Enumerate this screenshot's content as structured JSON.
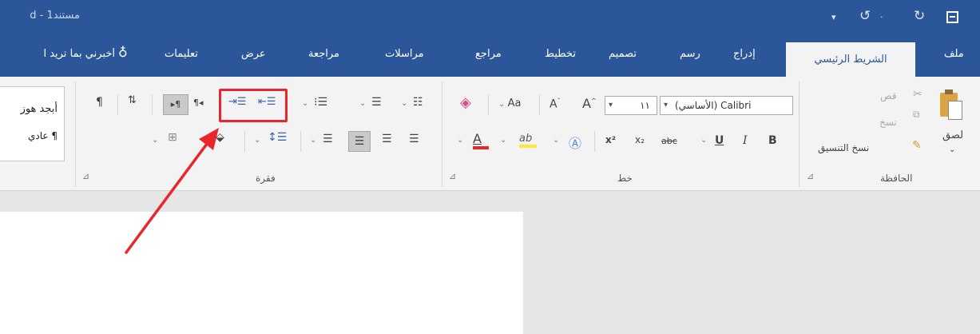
{
  "titlebar": {
    "doc_title": "مستند1 - d",
    "icons": [
      "save-icon",
      "redo-icon",
      "undo-icon",
      "customize-qat-icon"
    ]
  },
  "tabs": {
    "file": "ملف",
    "home": "الشريط الرئيسي",
    "insert": "إدراج",
    "draw": "رسم",
    "design": "تصميم",
    "layout": "تخطيط",
    "references": "مراجع",
    "mailings": "مراسلات",
    "review": "مراجعة",
    "view": "عرض",
    "help": "تعليمات",
    "tell_me": "أخبرني بما تريد ا"
  },
  "clipboard": {
    "paste": "لصق",
    "cut": "قص",
    "copy": "نسخ",
    "format_painter": "نسخ التنسيق",
    "group_label": "الحافظة"
  },
  "font": {
    "font_name": "Calibri (الأساسي)",
    "font_size": "١١",
    "change_case": "Aa",
    "bold": "B",
    "italic": "I",
    "underline": "U",
    "strikethrough": "abc",
    "subscript": "x₂",
    "superscript": "x²",
    "font_color_letter": "A",
    "group_label": "خط"
  },
  "paragraph": {
    "group_label": "فقرة",
    "icons": [
      "bullets-icon",
      "numbering-icon",
      "multilevel-list-icon",
      "decrease-indent-icon",
      "increase-indent-icon",
      "rtl-icon",
      "ltr-icon",
      "sort-icon",
      "show-marks-icon",
      "align-right-icon",
      "center-icon",
      "align-left-icon",
      "justify-icon",
      "line-spacing-icon",
      "shading-icon",
      "borders-icon"
    ]
  },
  "styles": {
    "style_1": "أبجد هوز",
    "style_2": "¶ عادي"
  },
  "annotation": {
    "highlight_color": "#e8262b"
  }
}
